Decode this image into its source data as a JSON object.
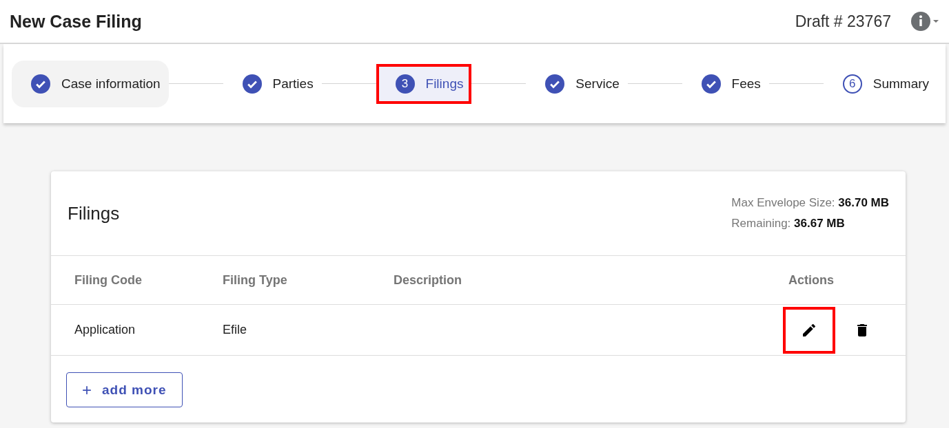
{
  "header": {
    "title": "New Case Filing",
    "draft": "Draft # 23767"
  },
  "steps": [
    {
      "label": "Case information",
      "kind": "done",
      "hovered": true,
      "highlighted": false
    },
    {
      "label": "Parties",
      "kind": "done",
      "hovered": false,
      "highlighted": false
    },
    {
      "label": "Filings",
      "kind": "current",
      "number": "3",
      "hovered": false,
      "highlighted": true
    },
    {
      "label": "Service",
      "kind": "done",
      "hovered": false,
      "highlighted": false
    },
    {
      "label": "Fees",
      "kind": "done",
      "hovered": false,
      "highlighted": false
    },
    {
      "label": "Summary",
      "kind": "pending",
      "number": "6",
      "hovered": false,
      "highlighted": false
    }
  ],
  "card": {
    "title": "Filings",
    "max_size_label": "Max Envelope Size:",
    "max_size": "36.70 MB",
    "remaining_label": "Remaining:",
    "remaining": "36.67 MB",
    "columns": [
      "Filing Code",
      "Filing Type",
      "Description",
      "Actions"
    ],
    "rows": [
      {
        "code": "Application",
        "type": "Efile",
        "edit_highlighted": true
      }
    ],
    "add_button": {
      "icon": "+",
      "label": "add more"
    }
  }
}
